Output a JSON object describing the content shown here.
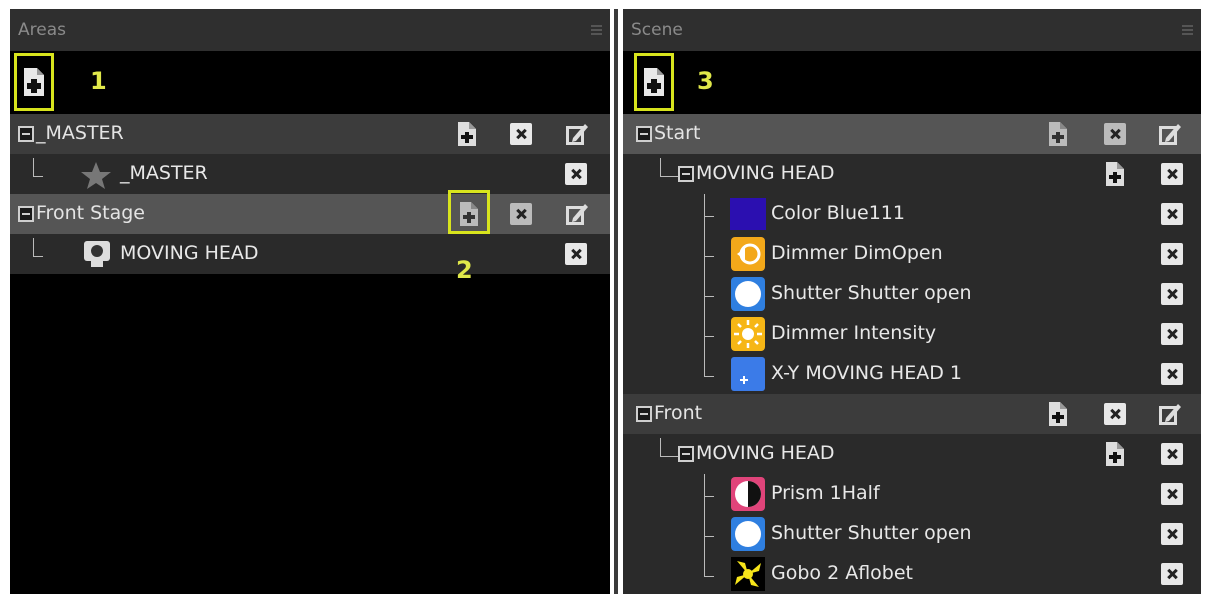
{
  "areas": {
    "title": "Areas",
    "callouts": [
      "1",
      "2"
    ],
    "rows": [
      {
        "label": "_MASTER"
      },
      {
        "label": "_MASTER"
      },
      {
        "label": "Front Stage"
      },
      {
        "label": "MOVING HEAD"
      }
    ]
  },
  "scene": {
    "title": "Scene",
    "callout": "3",
    "rows": [
      {
        "label": "Start"
      },
      {
        "label": "MOVING HEAD"
      },
      {
        "label": "Color Blue111"
      },
      {
        "label": "Dimmer DimOpen"
      },
      {
        "label": "Shutter Shutter open"
      },
      {
        "label": "Dimmer Intensity"
      },
      {
        "label": "X-Y MOVING HEAD  1"
      },
      {
        "label": "Front"
      },
      {
        "label": "MOVING HEAD"
      },
      {
        "label": "Prism 1Half"
      },
      {
        "label": "Shutter Shutter open"
      },
      {
        "label": "Gobo 2 Aflobet"
      }
    ]
  },
  "colors": {
    "highlight": "#d8e41d",
    "callout_text": "#e0e84a",
    "color_blue_swatch": "#2b0fb0",
    "dimmer_orange": "#f3a81a",
    "shutter_blue": "#2f7fe0",
    "intensity_orange": "#f6b616",
    "xy_blue": "#3b7be8",
    "prism_pink": "#e0447a",
    "gobo_yellow": "#f7e51a"
  },
  "icons": {
    "add": "add-document-icon",
    "delete": "delete-x-icon",
    "edit": "edit-pencil-icon",
    "collapse": "collapse-minus-icon",
    "star": "star-icon",
    "moving_head": "moving-head-icon",
    "dimmer": "dimmer-icon",
    "shutter": "shutter-icon",
    "intensity": "sun-icon",
    "xy": "move-arrows-icon",
    "prism": "prism-icon",
    "gobo": "gobo-icon"
  }
}
